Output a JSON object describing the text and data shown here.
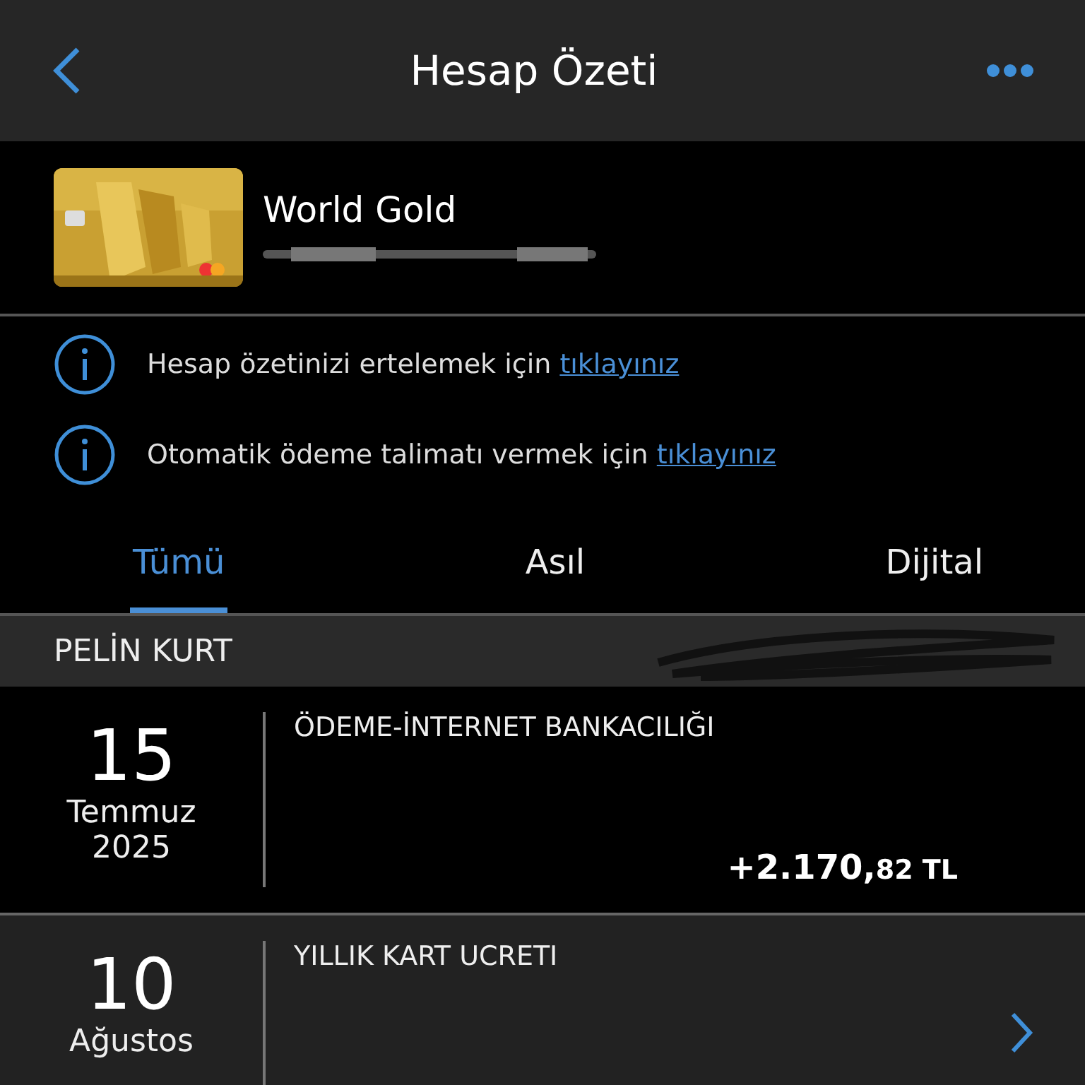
{
  "header": {
    "title": "Hesap Özeti"
  },
  "card": {
    "name": "World Gold"
  },
  "notices": [
    {
      "text": "Hesap özetinizi ertelemek için",
      "link": "tıklayınız"
    },
    {
      "text": "Otomatik ödeme talimatı vermek için",
      "link": "tıklayınız"
    }
  ],
  "tabs": [
    {
      "label": "Tümü",
      "selected": true
    },
    {
      "label": "Asıl",
      "selected": false
    },
    {
      "label": "Dijital",
      "selected": false
    }
  ],
  "section": {
    "holder": "PELİN KURT"
  },
  "transactions": [
    {
      "kind": "amount",
      "day": "15",
      "month": "Temmuz",
      "year": "2025",
      "description": "ÖDEME-İNTERNET BANKACILIĞI",
      "amount": "+2.170,",
      "amount_decimals": "82 TL"
    },
    {
      "kind": "detail",
      "day": "10",
      "month": "Ağustos",
      "description": "YILLIK KART UCRETI"
    }
  ]
}
